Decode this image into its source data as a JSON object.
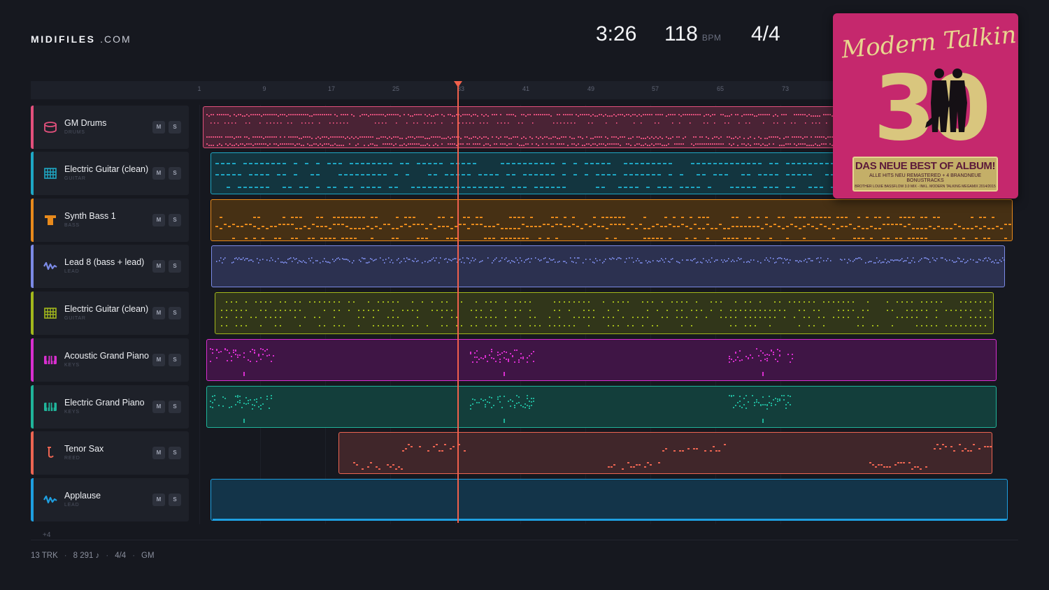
{
  "app": {
    "logo_brand": "MIDIFILES",
    "logo_domain": ".COM"
  },
  "transport": {
    "time": "3:26",
    "tempo": "118",
    "tempo_unit": "BPM",
    "time_signature": "4/4"
  },
  "ruler": {
    "bars": [
      "1",
      "9",
      "17",
      "25",
      "33",
      "41",
      "49",
      "57",
      "65",
      "73"
    ]
  },
  "tracks": [
    {
      "name": "GM Drums",
      "category": "DRUMS",
      "icon": "drum-icon",
      "color": "#e2507c",
      "mute": "M",
      "solo": "S"
    },
    {
      "name": "Electric Guitar (clean)",
      "category": "GUITAR",
      "icon": "guitar-icon",
      "color": "#1ea7c4",
      "mute": "M",
      "solo": "S"
    },
    {
      "name": "Synth Bass 1",
      "category": "BASS",
      "icon": "bass-icon",
      "color": "#e88a1c",
      "mute": "M",
      "solo": "S"
    },
    {
      "name": "Lead 8 (bass + lead)",
      "category": "LEAD",
      "icon": "wave-icon",
      "color": "#7b8ae6",
      "mute": "M",
      "solo": "S"
    },
    {
      "name": "Electric Guitar (clean)",
      "category": "GUITAR",
      "icon": "guitar-icon",
      "color": "#a2b81c",
      "mute": "M",
      "solo": "S"
    },
    {
      "name": "Acoustic Grand Piano",
      "category": "KEYS",
      "icon": "piano-icon",
      "color": "#d82fcf",
      "mute": "M",
      "solo": "S"
    },
    {
      "name": "Electric Grand Piano",
      "category": "KEYS",
      "icon": "piano-icon",
      "color": "#20b49a",
      "mute": "M",
      "solo": "S"
    },
    {
      "name": "Tenor Sax",
      "category": "REED",
      "icon": "sax-icon",
      "color": "#ec6552",
      "mute": "M",
      "solo": "S"
    },
    {
      "name": "Applause",
      "category": "LEAD",
      "icon": "wave-icon",
      "color": "#1e9fe0",
      "mute": "M",
      "solo": "S"
    }
  ],
  "more_tracks": "+4",
  "footer": {
    "tracks": "13 TRK",
    "notes": "8 291 ♪",
    "time_signature": "4/4",
    "standard": "GM"
  },
  "album": {
    "title": "Modern Talking",
    "number": "30",
    "badge_line1": "DAS NEUE BEST OF ALBUM!",
    "badge_line2": "ALLE HITS NEU REMASTERED + 4 BRANDNEUE BONUSTRACKS",
    "badge_line3": "BROTHER LOUIE BASSFLOW 3.0 MIX - INKL. MODERN TALKING MEGAMIX 2014/2015"
  }
}
